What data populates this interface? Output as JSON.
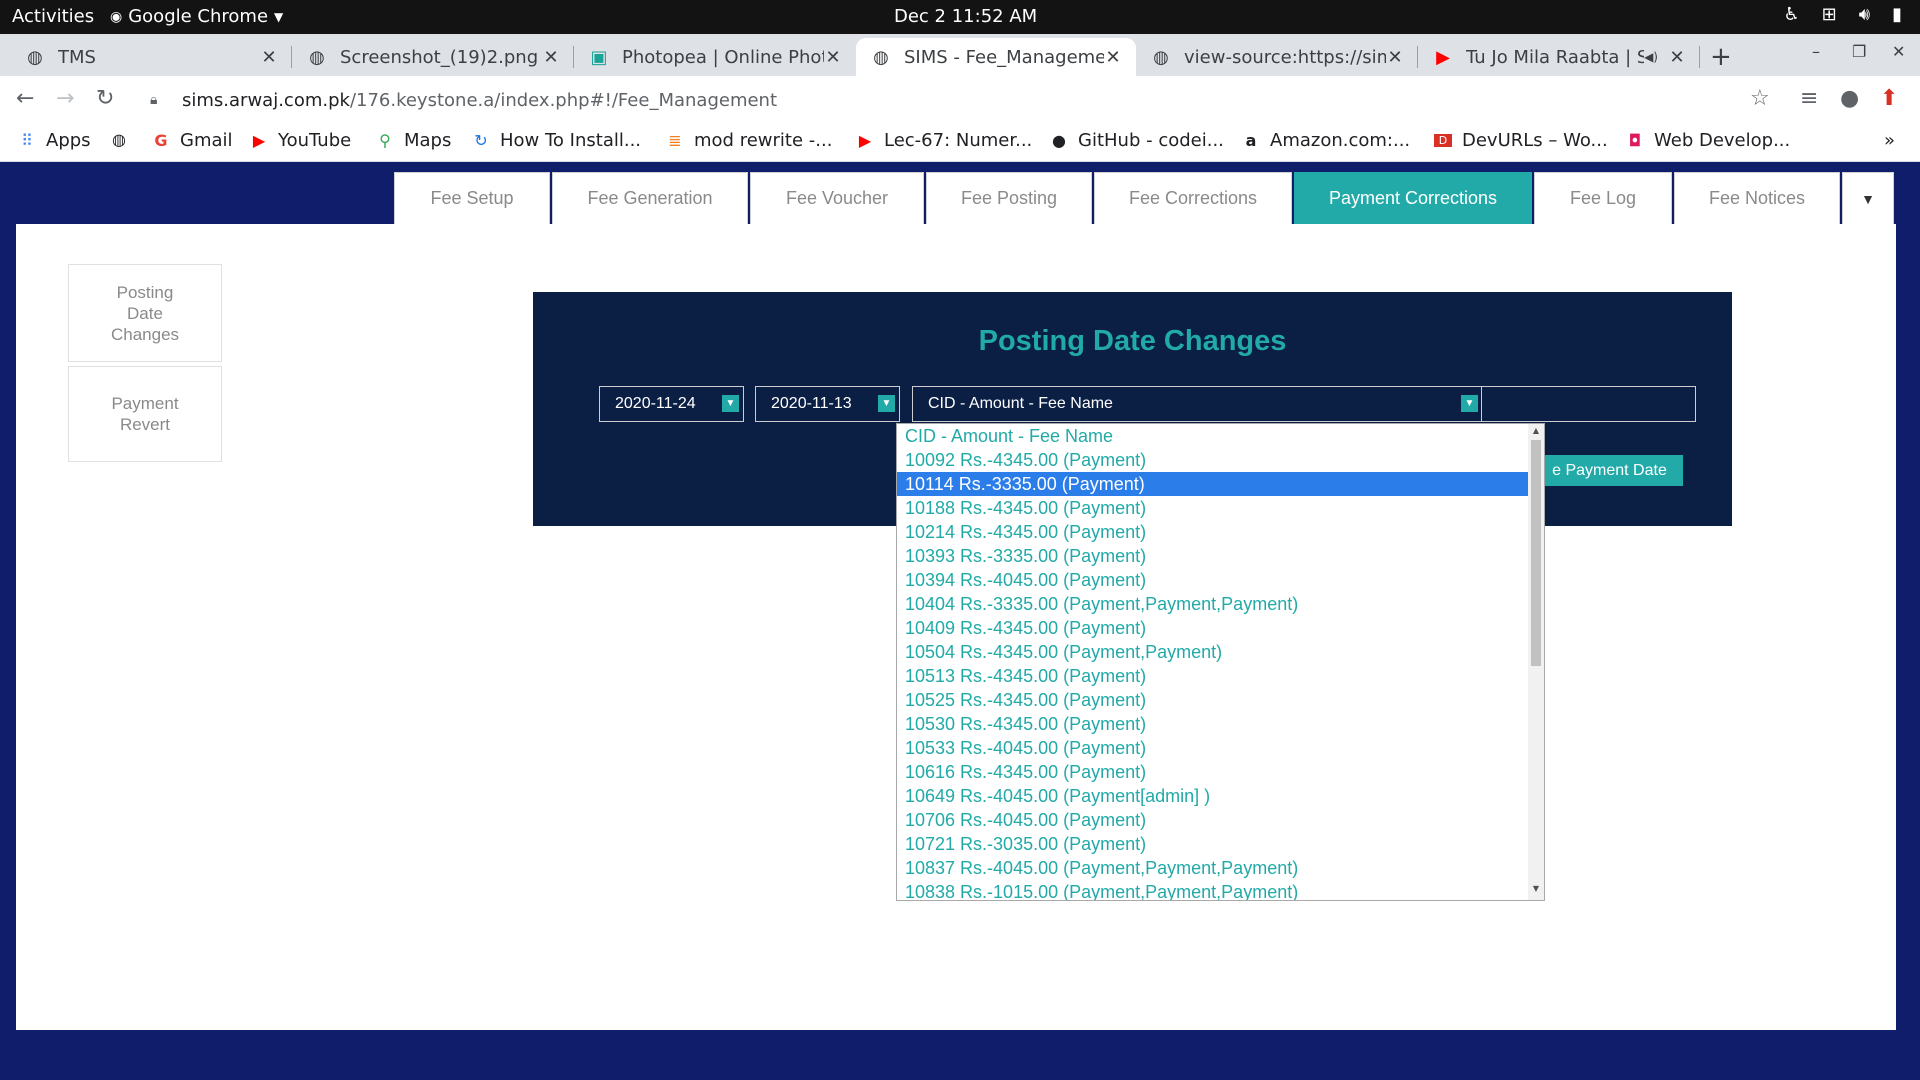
{
  "system": {
    "activities": "Activities",
    "app_name": "Google Chrome",
    "clock": "Dec 2  11:52 AM"
  },
  "tabs": [
    {
      "label": "TMS",
      "icon": "globe-icon"
    },
    {
      "label": "Screenshot_(19)2.png (",
      "icon": "globe-icon"
    },
    {
      "label": "Photopea | Online Phot",
      "icon": "photopea-icon"
    },
    {
      "label": "SIMS - Fee_Managemen",
      "icon": "globe-icon",
      "active": true
    },
    {
      "label": "view-source:https://sim",
      "icon": "globe-icon"
    },
    {
      "label": "Tu Jo Mila Raabta | S",
      "icon": "youtube-icon"
    }
  ],
  "address": {
    "host": "sims.arwaj.com.pk",
    "path": "/176.keystone.a/index.php#!/Fee_Management"
  },
  "bookmarks": [
    {
      "label": "Apps",
      "icon": "apps-grid-icon"
    },
    {
      "label": "",
      "icon": "globe-icon"
    },
    {
      "label": "Gmail",
      "icon": "google-icon"
    },
    {
      "label": "YouTube",
      "icon": "youtube-icon"
    },
    {
      "label": "Maps",
      "icon": "maps-pin-icon"
    },
    {
      "label": "How To Install...",
      "icon": "refresh-logo-icon"
    },
    {
      "label": "mod rewrite -...",
      "icon": "stackoverflow-icon"
    },
    {
      "label": "Lec-67: Numer...",
      "icon": "youtube-icon"
    },
    {
      "label": "GitHub - codei...",
      "icon": "github-icon"
    },
    {
      "label": "Amazon.com:...",
      "icon": "amazon-icon"
    },
    {
      "label": "DevURLs – Wo...",
      "icon": "devurls-icon"
    },
    {
      "label": "Web Develop...",
      "icon": "webdev-icon"
    }
  ],
  "fee_tabs": [
    {
      "label": "Fee Setup"
    },
    {
      "label": "Fee Generation"
    },
    {
      "label": "Fee Voucher"
    },
    {
      "label": "Fee Posting"
    },
    {
      "label": "Fee Corrections"
    },
    {
      "label": "Payment Corrections",
      "active": true
    },
    {
      "label": "Fee Log"
    },
    {
      "label": "Fee Notices"
    }
  ],
  "sidebar": {
    "posting_date_changes": "Posting Date Changes",
    "payment_revert": "Payment Revert"
  },
  "panel": {
    "title": "Posting Date Changes",
    "date_from": "2020-11-24",
    "date_to": "2020-11-13",
    "record_select": "CID - Amount - Fee Name",
    "new_date_value": "",
    "save_button": "e Payment Date"
  },
  "dropdown": {
    "selected_index": 2,
    "options": [
      "CID - Amount - Fee Name",
      "10092 Rs.-4345.00 (Payment)",
      "10114 Rs.-3335.00 (Payment)",
      "10188 Rs.-4345.00 (Payment)",
      "10214 Rs.-4345.00 (Payment)",
      "10393 Rs.-3335.00 (Payment)",
      "10394 Rs.-4045.00 (Payment)",
      "10404 Rs.-3335.00 (Payment,Payment,Payment)",
      "10409 Rs.-4345.00 (Payment)",
      "10504 Rs.-4345.00 (Payment,Payment)",
      "10513 Rs.-4345.00 (Payment)",
      "10525 Rs.-4345.00 (Payment)",
      "10530 Rs.-4345.00 (Payment)",
      "10533 Rs.-4045.00 (Payment)",
      "10616 Rs.-4345.00 (Payment)",
      "10649 Rs.-4045.00 (Payment[admin] )",
      "10706 Rs.-4045.00 (Payment)",
      "10721 Rs.-3035.00 (Payment)",
      "10837 Rs.-4045.00 (Payment,Payment,Payment)",
      "10838 Rs.-1015.00 (Payment,Payment,Payment)"
    ]
  },
  "colors": {
    "teal": "#22aaa8",
    "panel_bg": "#0b1f45",
    "page_bg": "#101d6b",
    "selected_option": "#2b7de9"
  }
}
